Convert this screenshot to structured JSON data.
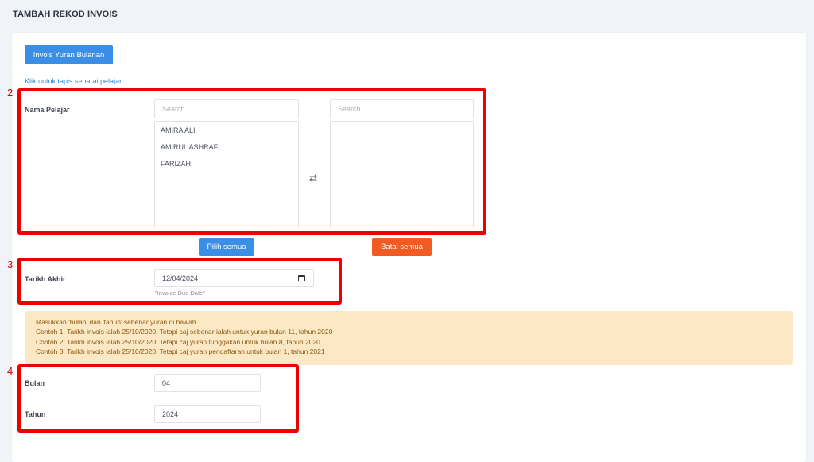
{
  "page": {
    "title": "TAMBAH REKOD INVOIS"
  },
  "actions": {
    "invoice_type_button": "Invois Yuran Bulanan",
    "filter_link": "Klik untuk tapis senarai pelajar"
  },
  "student_picker": {
    "label": "Nama Pelajar",
    "left_search_placeholder": "Search..",
    "right_search_placeholder": "Search..",
    "available": [
      "AMIRA ALI",
      "AMIRUL ASHRAF",
      "FARIZAH"
    ],
    "selected": [],
    "transfer_icon": "⇄",
    "select_all_label": "Pilih semua",
    "cancel_all_label": "Batal semua"
  },
  "due_date": {
    "label": "Tarikh Akhir",
    "value": "12/04/2024",
    "hint": "\"Invoice Due Date\""
  },
  "notice": {
    "lines": [
      "Masukkan 'bulan' dan 'tahun' sebenar yuran di bawah",
      "Contoh 1: Tarikh invois ialah 25/10/2020. Tetapi caj sebenar ialah untuk yuran bulan 11, tahun 2020",
      "Contoh 2: Tarikh invois ialah 25/10/2020. Tetapi caj yuran tunggakan untuk bulan 8, tahun 2020",
      "Contoh 3: Tarikh invois ialah 25/10/2020. Tetapi caj yuran pendaftaran untuk bulan 1, tahun 2021"
    ]
  },
  "period": {
    "month_label": "Bulan",
    "month_value": "04",
    "year_label": "Tahun",
    "year_value": "2024"
  },
  "annotations": {
    "box2": "2",
    "box3": "3",
    "box4": "4"
  },
  "colors": {
    "accent_blue": "#3a8ee6",
    "danger_orange": "#f15a22",
    "annotation_red": "#ee0000",
    "notice_bg": "#fde8c6"
  }
}
